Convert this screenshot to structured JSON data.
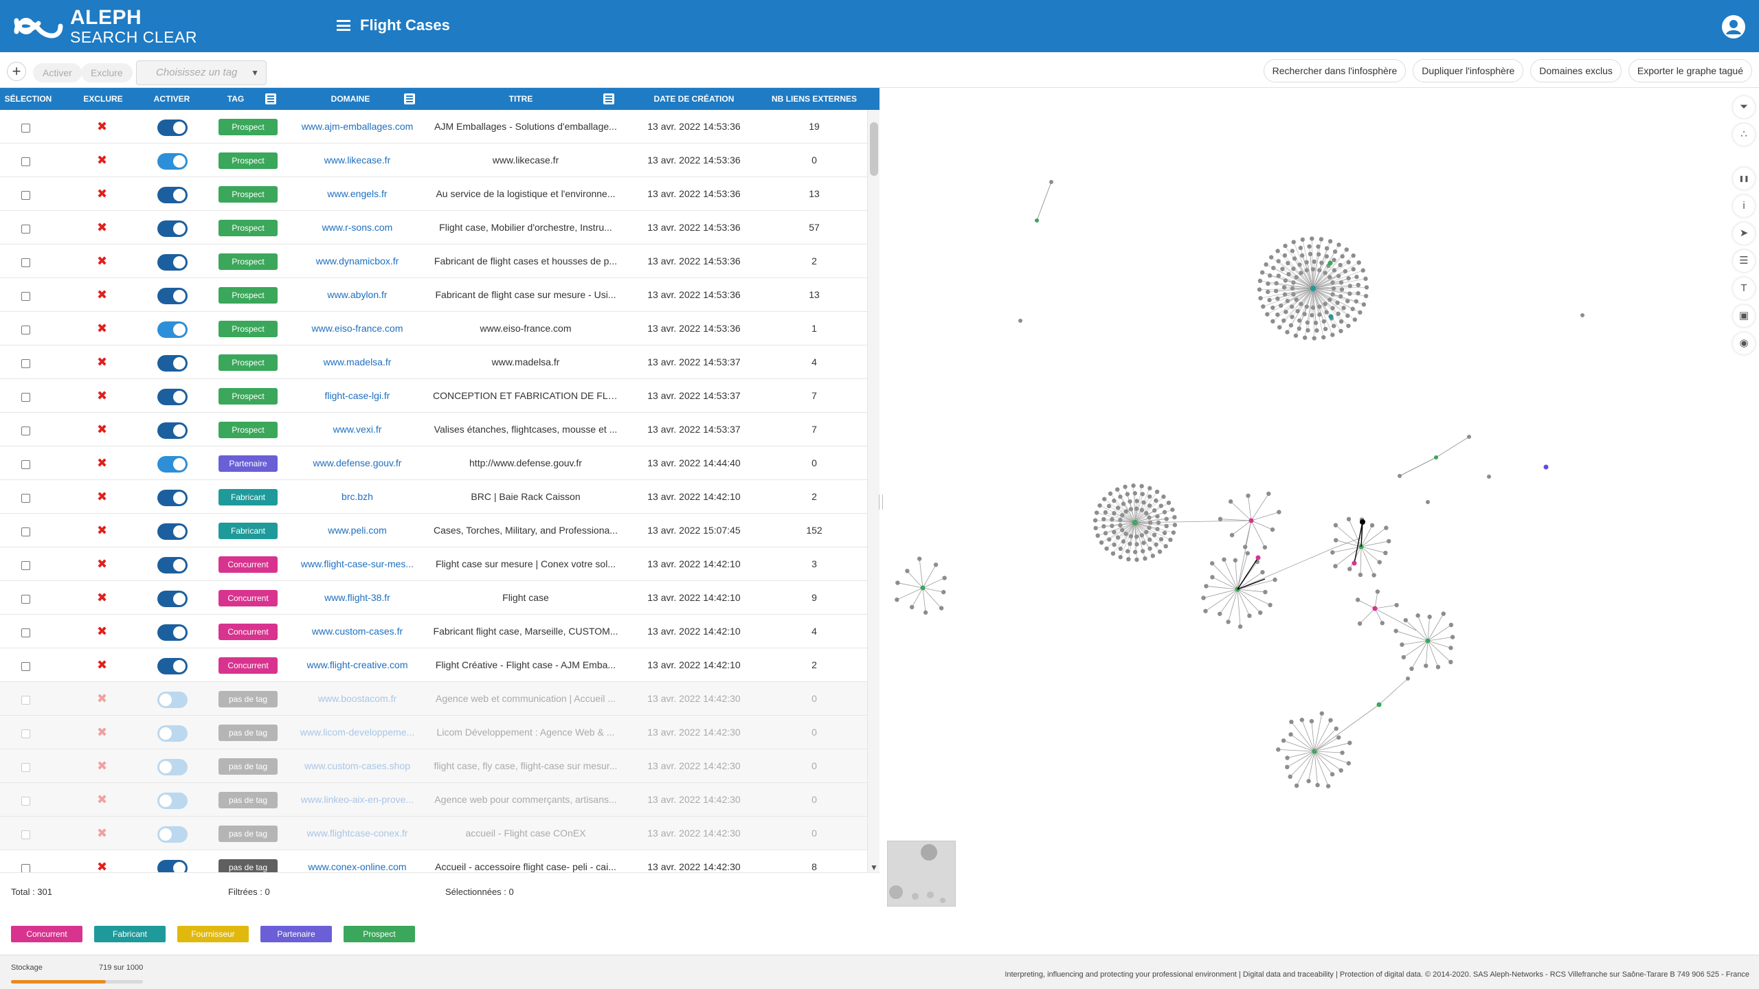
{
  "app": {
    "logo_line1": "ALEPH",
    "logo_line2": "SEARCH CLEAR",
    "page_title": "Flight Cases"
  },
  "toolbar": {
    "add_label": "+",
    "activate_label": "Activer",
    "exclude_label": "Exclure",
    "tag_placeholder": "Choisissez un tag",
    "right_buttons": [
      "Rechercher dans l'infosphère",
      "Dupliquer l'infosphère",
      "Domaines exclus",
      "Exporter le graphe tagué"
    ]
  },
  "table": {
    "headers": {
      "selection": "Sélection",
      "exclude": "Exclure",
      "activate": "Activer",
      "tag": "Tag",
      "domain": "Domaine",
      "title": "Titre",
      "created": "Date de création",
      "links": "NB liens externes"
    },
    "rows": [
      {
        "active": true,
        "tag": "Prospect",
        "domain": "www.ajm-emballages.com",
        "title": "AJM Emballages - Solutions d'emballage...",
        "date": "13 avr. 2022 14:53:36",
        "links": "19"
      },
      {
        "active": true,
        "tag": "Prospect",
        "domain": "www.likecase.fr",
        "title": "www.likecase.fr",
        "date": "13 avr. 2022 14:53:36",
        "links": "0"
      },
      {
        "active": true,
        "tag": "Prospect",
        "domain": "www.engels.fr",
        "title": "Au service de la logistique et l'environne...",
        "date": "13 avr. 2022 14:53:36",
        "links": "13"
      },
      {
        "active": true,
        "tag": "Prospect",
        "domain": "www.r-sons.com",
        "title": "Flight case, Mobilier d'orchestre, Instru...",
        "date": "13 avr. 2022 14:53:36",
        "links": "57"
      },
      {
        "active": true,
        "tag": "Prospect",
        "domain": "www.dynamicbox.fr",
        "title": "Fabricant de flight cases et housses de p...",
        "date": "13 avr. 2022 14:53:36",
        "links": "2"
      },
      {
        "active": true,
        "tag": "Prospect",
        "domain": "www.abylon.fr",
        "title": "Fabricant de flight case sur mesure - Usi...",
        "date": "13 avr. 2022 14:53:36",
        "links": "13"
      },
      {
        "active": true,
        "tag": "Prospect",
        "domain": "www.eiso-france.com",
        "title": "www.eiso-france.com",
        "date": "13 avr. 2022 14:53:36",
        "links": "1"
      },
      {
        "active": true,
        "tag": "Prospect",
        "domain": "www.madelsa.fr",
        "title": "www.madelsa.fr",
        "date": "13 avr. 2022 14:53:37",
        "links": "4"
      },
      {
        "active": true,
        "tag": "Prospect",
        "domain": "flight-case-lgi.fr",
        "title": "CONCEPTION ET FABRICATION DE FLIG...",
        "date": "13 avr. 2022 14:53:37",
        "links": "7"
      },
      {
        "active": true,
        "tag": "Prospect",
        "domain": "www.vexi.fr",
        "title": "Valises étanches, flightcases, mousse et ...",
        "date": "13 avr. 2022 14:53:37",
        "links": "7"
      },
      {
        "active": true,
        "tag": "Partenaire",
        "domain": "www.defense.gouv.fr",
        "title": "http://www.defense.gouv.fr",
        "date": "13 avr. 2022 14:44:40",
        "links": "0"
      },
      {
        "active": true,
        "tag": "Fabricant",
        "domain": "brc.bzh",
        "title": "BRC | Baie Rack Caisson",
        "date": "13 avr. 2022 14:42:10",
        "links": "2"
      },
      {
        "active": true,
        "tag": "Fabricant",
        "domain": "www.peli.com",
        "title": "Cases, Torches, Military, and Professiona...",
        "date": "13 avr. 2022 15:07:45",
        "links": "152"
      },
      {
        "active": true,
        "tag": "Concurrent",
        "domain": "www.flight-case-sur-mes...",
        "title": "Flight case sur mesure | Conex votre sol...",
        "date": "13 avr. 2022 14:42:10",
        "links": "3"
      },
      {
        "active": true,
        "tag": "Concurrent",
        "domain": "www.flight-38.fr",
        "title": "Flight case",
        "date": "13 avr. 2022 14:42:10",
        "links": "9"
      },
      {
        "active": true,
        "tag": "Concurrent",
        "domain": "www.custom-cases.fr",
        "title": "Fabricant flight case, Marseille, CUSTOM...",
        "date": "13 avr. 2022 14:42:10",
        "links": "4"
      },
      {
        "active": true,
        "tag": "Concurrent",
        "domain": "www.flight-creative.com",
        "title": "Flight Créative - Flight case - AJM Emba...",
        "date": "13 avr. 2022 14:42:10",
        "links": "2"
      },
      {
        "active": false,
        "tag": "pas de tag",
        "domain": "www.boostacom.fr",
        "title": "Agence web et communication | Accueil ...",
        "date": "13 avr. 2022 14:42:30",
        "links": "0"
      },
      {
        "active": false,
        "tag": "pas de tag",
        "domain": "www.licom-developpeme...",
        "title": "Licom Développement : Agence Web & ...",
        "date": "13 avr. 2022 14:42:30",
        "links": "0"
      },
      {
        "active": false,
        "tag": "pas de tag",
        "domain": "www.custom-cases.shop",
        "title": "flight case, fly case, flight-case sur mesur...",
        "date": "13 avr. 2022 14:42:30",
        "links": "0"
      },
      {
        "active": false,
        "tag": "pas de tag",
        "domain": "www.linkeo-aix-en-prove...",
        "title": "Agence web pour commerçants, artisans...",
        "date": "13 avr. 2022 14:42:30",
        "links": "0"
      },
      {
        "active": false,
        "tag": "pas de tag",
        "domain": "www.flightcase-conex.fr",
        "title": "accueil - Flight case COnEX",
        "date": "13 avr. 2022 14:42:30",
        "links": "0"
      },
      {
        "active": true,
        "tag": "pas de tag",
        "domain": "www.conex-online.com",
        "title": "Accueil - accessoire flight case- peli - cai...",
        "date": "13 avr. 2022 14:42:30",
        "links": "8"
      }
    ]
  },
  "stats": {
    "total": "Total : 301",
    "filtered": "Filtrées : 0",
    "selected": "Sélectionnées : 0"
  },
  "legend": [
    {
      "label": "Concurrent",
      "color": "#d8338e"
    },
    {
      "label": "Fabricant",
      "color": "#1f9a9a"
    },
    {
      "label": "Fournisseur",
      "color": "#e1b90e"
    },
    {
      "label": "Partenaire",
      "color": "#6a5fd6"
    },
    {
      "label": "Prospect",
      "color": "#3aa75a"
    }
  ],
  "tag_colors": {
    "Prospect": "#3aa75a",
    "Partenaire": "#6a5fd6",
    "Fabricant": "#1f9a9a",
    "Concurrent": "#d8338e",
    "Fournisseur": "#e1b90e",
    "pas de tag": "#b5b5b5",
    "pas de tag active": "#5f5f5f"
  },
  "storage": {
    "label": "Stockage",
    "value": "719 sur 1000",
    "fraction": 0.719
  },
  "copyright": "Interpreting, influencing and protecting your professional environment | Digital data and traceability | Protection of digital data. © 2014-2020. SAS Aleph-Networks - RCS Villefranche sur Saône-Tarare B 749 906 525 - France",
  "graph_tools": [
    "filter-icon",
    "scatter-icon",
    "pause-icon",
    "info-icon",
    "cursor-icon",
    "layers-icon",
    "text-icon",
    "image-icon",
    "camera-icon"
  ]
}
